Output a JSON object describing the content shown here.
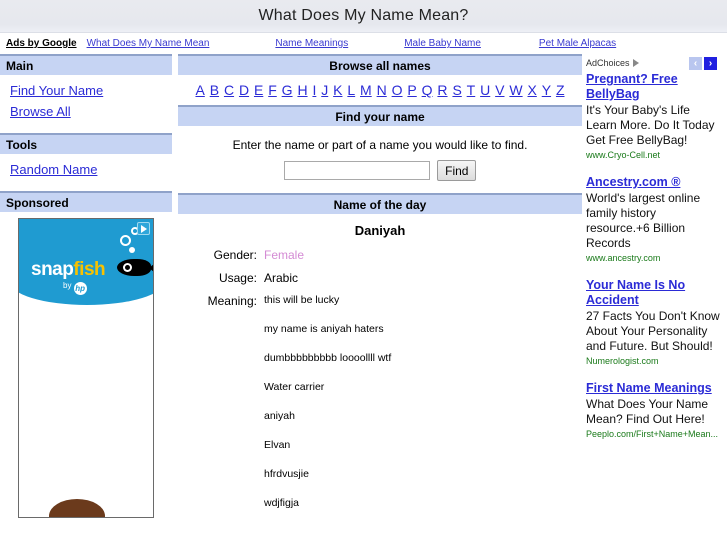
{
  "banner": {
    "title": "What Does My Name Mean?"
  },
  "adstrip": {
    "label": "Ads by Google",
    "links": [
      "What Does My Name Mean",
      "Name Meanings",
      "Male Baby Name",
      "Pet Male Alpacas"
    ]
  },
  "sidebar": {
    "sections": [
      {
        "heading": "Main",
        "items": [
          "Find Your Name",
          "Browse All"
        ]
      },
      {
        "heading": "Tools",
        "items": [
          "Random Name"
        ]
      },
      {
        "heading": "Sponsored",
        "items": []
      }
    ],
    "ad": {
      "brand_first": "snap",
      "brand_second": "fish",
      "byline": "by",
      "hp_logo": "hp"
    }
  },
  "browse": {
    "heading": "Browse all names",
    "letters": [
      "A",
      "B",
      "C",
      "D",
      "E",
      "F",
      "G",
      "H",
      "I",
      "J",
      "K",
      "L",
      "M",
      "N",
      "O",
      "P",
      "Q",
      "R",
      "S",
      "T",
      "U",
      "V",
      "W",
      "X",
      "Y",
      "Z"
    ]
  },
  "find": {
    "heading": "Find your name",
    "prompt": "Enter the name or part of a name you would like to find.",
    "input_value": "",
    "input_placeholder": "",
    "button_label": "Find"
  },
  "name_of_day": {
    "heading": "Name of the day",
    "name": "Daniyah",
    "fields": [
      {
        "label": "Gender:",
        "value": "Female"
      },
      {
        "label": "Usage:",
        "value": "Arabic"
      },
      {
        "label": "Meaning:",
        "value": "this will be lucky"
      }
    ],
    "meanings": [
      "my name is aniyah haters",
      "dumbbbbbbbbb loooollll wtf",
      "Water carrier",
      "aniyah",
      "Elvan",
      "hfrdvusjie",
      "wdjfigja"
    ]
  },
  "ads": {
    "adchoices_label": "AdChoices",
    "prev_arrow": "‹",
    "next_arrow": "›",
    "items": [
      {
        "title": "Pregnant? Free BellyBag",
        "body": "It's Your Baby's Life Learn More. Do It Today Get Free BellyBag!",
        "url": "www.Cryo-Cell.net"
      },
      {
        "title": "Ancestry.com ®",
        "body": "World's largest online family history resource.+6 Billion Records",
        "url": "www.ancestry.com"
      },
      {
        "title": "Your Name Is No Accident",
        "body": "27 Facts You Don't Know About Your Personality and Future. But Should!",
        "url": "Numerologist.com"
      },
      {
        "title": "First Name Meanings",
        "body": "What Does Your Name Mean? Find Out Here!",
        "url": "Peeplо.com/First+Name+Mean..."
      }
    ]
  },
  "colors": {
    "header_blue": "#c6d4f3",
    "header_border": "#8fa2c9",
    "link_blue": "#2b2bd6",
    "female_pink": "#d48bd4",
    "ad_url_green": "#1a7a1a"
  }
}
